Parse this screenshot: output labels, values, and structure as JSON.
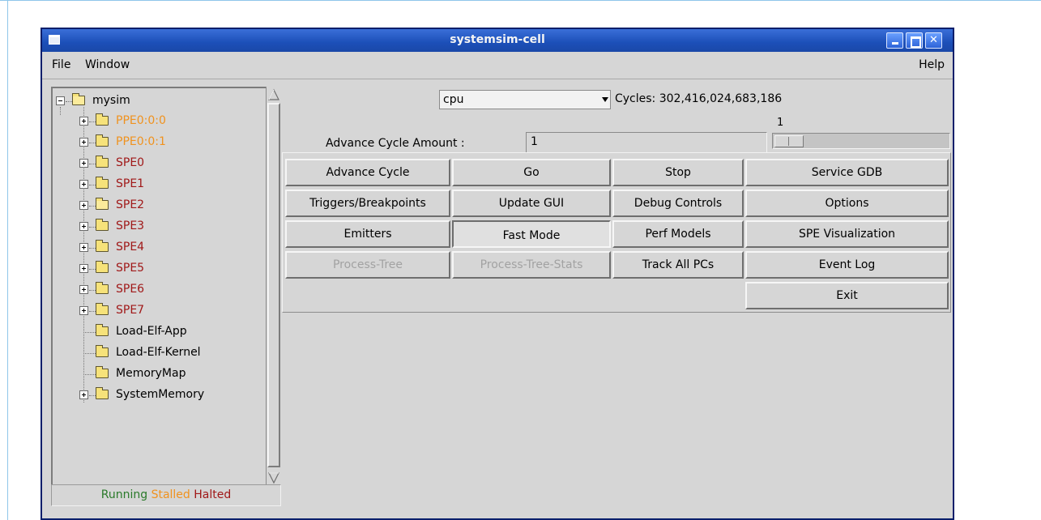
{
  "window": {
    "title": "systemsim-cell"
  },
  "menubar": {
    "file": "File",
    "window": "Window",
    "help": "Help"
  },
  "tree": {
    "root": "mysim",
    "items": [
      {
        "label": "PPE0:0:0",
        "color": "#f0921e",
        "expandable": true
      },
      {
        "label": "PPE0:0:1",
        "color": "#f0921e",
        "expandable": true
      },
      {
        "label": "SPE0",
        "color": "#a01818",
        "expandable": true
      },
      {
        "label": "SPE1",
        "color": "#a01818",
        "expandable": true
      },
      {
        "label": "SPE2",
        "color": "#a01818",
        "expandable": true,
        "open": true
      },
      {
        "label": "SPE3",
        "color": "#a01818",
        "expandable": true
      },
      {
        "label": "SPE4",
        "color": "#a01818",
        "expandable": true
      },
      {
        "label": "SPE5",
        "color": "#a01818",
        "expandable": true
      },
      {
        "label": "SPE6",
        "color": "#a01818",
        "expandable": true
      },
      {
        "label": "SPE7",
        "color": "#a01818",
        "expandable": true
      },
      {
        "label": "Load-Elf-App",
        "color": "#000000",
        "expandable": false
      },
      {
        "label": "Load-Elf-Kernel",
        "color": "#000000",
        "expandable": false
      },
      {
        "label": "MemoryMap",
        "color": "#000000",
        "expandable": false
      },
      {
        "label": "SystemMemory",
        "color": "#000000",
        "expandable": true
      }
    ]
  },
  "legend": {
    "running": "Running",
    "stalled": "Stalled",
    "halted": "Halted"
  },
  "cpu_select": {
    "value": "cpu"
  },
  "cycles": "Cycles: 302,416,024,683,186",
  "advance": {
    "label": "Advance Cycle Amount :",
    "value": "1",
    "slider_value": "1"
  },
  "buttons": {
    "advance_cycle": "Advance Cycle",
    "go": "Go",
    "stop": "Stop",
    "service_gdb": "Service GDB",
    "triggers_breakpoints": "Triggers/Breakpoints",
    "update_gui": "Update GUI",
    "debug_controls": "Debug Controls",
    "options": "Options",
    "emitters": "Emitters",
    "fast_mode": "Fast Mode",
    "perf_models": "Perf Models",
    "spe_visualization": "SPE Visualization",
    "process_tree": "Process-Tree",
    "process_tree_stats": "Process-Tree-Stats",
    "track_all_pcs": "Track All PCs",
    "event_log": "Event Log",
    "exit": "Exit"
  }
}
